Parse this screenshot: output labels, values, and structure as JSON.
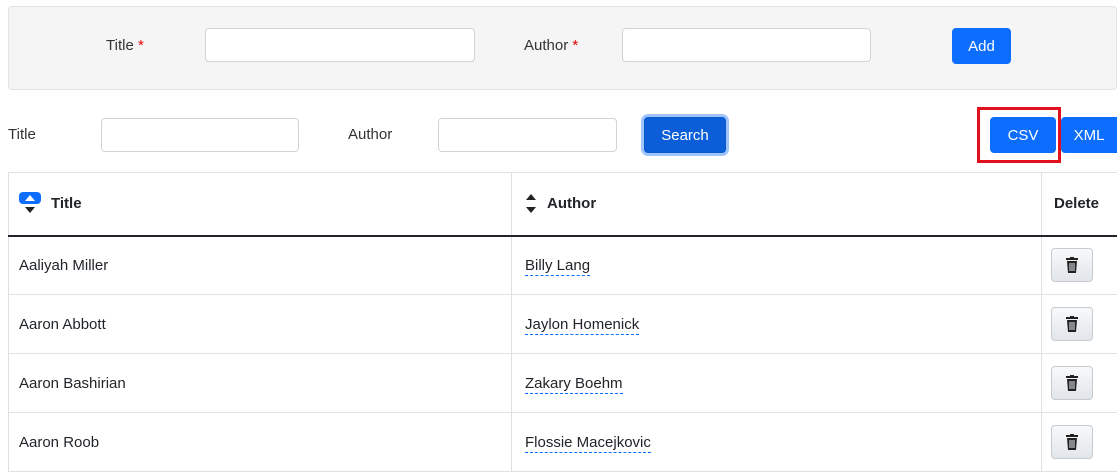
{
  "add_form": {
    "title_label": "Title",
    "author_label": "Author",
    "required_mark": "*",
    "title_value": "",
    "author_value": "",
    "add_label": "Add"
  },
  "search_form": {
    "title_label": "Title",
    "author_label": "Author",
    "title_value": "",
    "author_value": "",
    "search_label": "Search"
  },
  "export": {
    "csv_label": "CSV",
    "xml_label": "XML"
  },
  "table": {
    "headers": {
      "title": "Title",
      "author": "Author",
      "delete": "Delete"
    },
    "sort": {
      "column": "title",
      "direction": "ascending"
    },
    "rows": [
      {
        "title": "Aaliyah Miller",
        "author": "Billy Lang"
      },
      {
        "title": "Aaron Abbott",
        "author": "Jaylon Homenick"
      },
      {
        "title": "Aaron Bashirian",
        "author": "Zakary Boehm"
      },
      {
        "title": "Aaron Roob",
        "author": "Flossie Macejkovic"
      }
    ]
  },
  "icons": {
    "sort_active": "sort-ascending-icon",
    "sort_idle": "sort-icon",
    "delete": "trash-icon"
  },
  "colors": {
    "primary": "#0d6efd",
    "highlight": "#e0101d",
    "required": "#e00000",
    "panel_bg": "#f5f5f5"
  }
}
